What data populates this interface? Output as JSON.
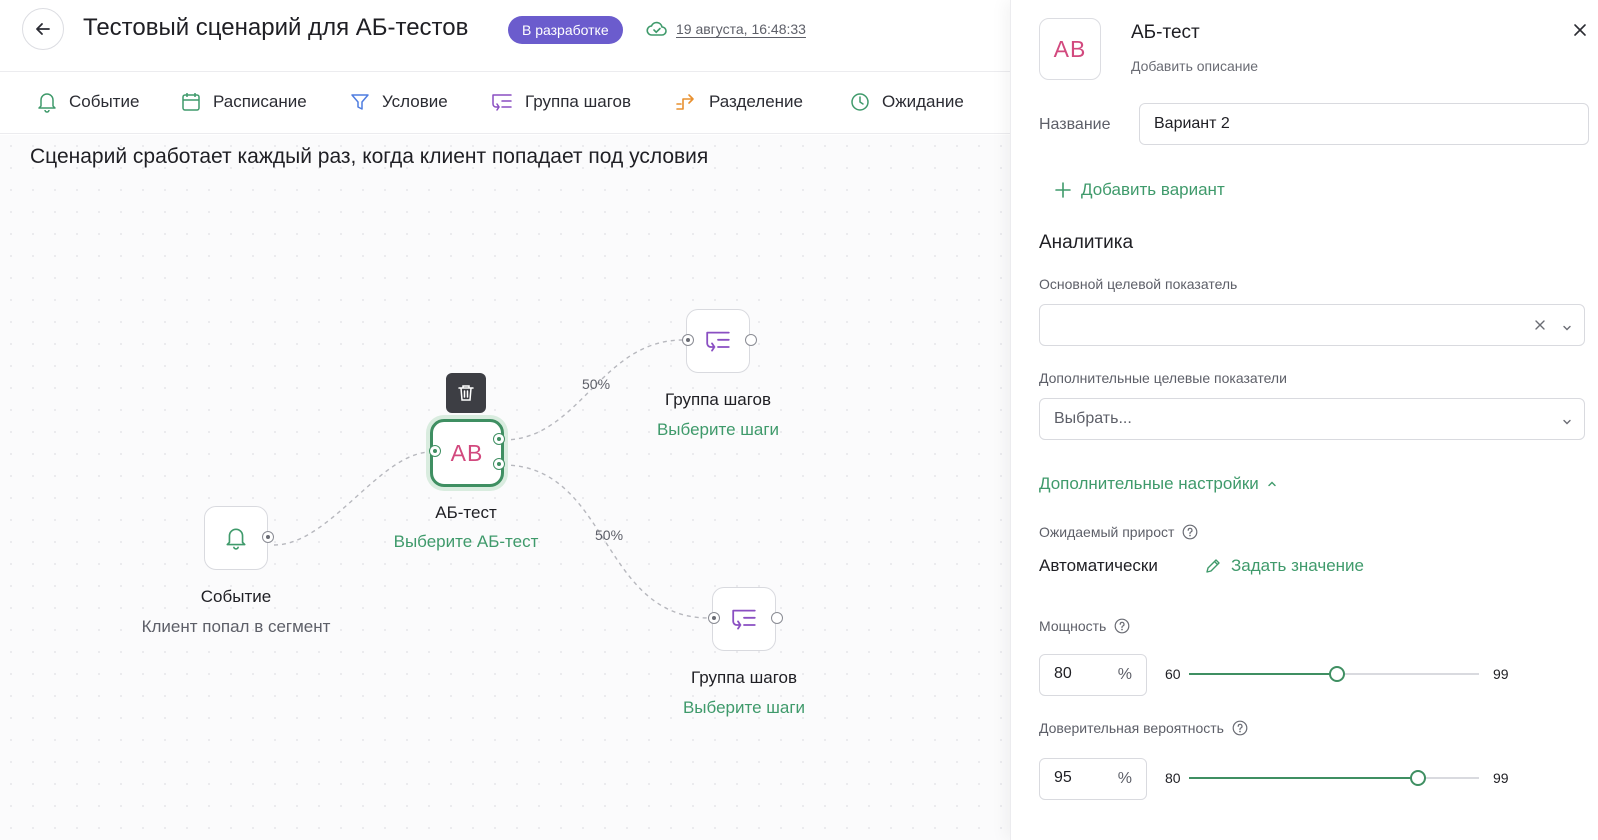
{
  "header": {
    "title": "Тестовый сценарий для АБ-тестов",
    "status": "В разработке",
    "saved_at": "19 августа, 16:48:33"
  },
  "toolbar": {
    "items": [
      {
        "label": "Событие",
        "icon": "bell-icon"
      },
      {
        "label": "Расписание",
        "icon": "calendar-icon"
      },
      {
        "label": "Условие",
        "icon": "filter-icon"
      },
      {
        "label": "Группа шагов",
        "icon": "step-group-icon"
      },
      {
        "label": "Разделение",
        "icon": "split-icon"
      },
      {
        "label": "Ожидание",
        "icon": "clock-icon"
      }
    ]
  },
  "canvas": {
    "hint": "Сценарий сработает каждый раз, когда клиент попадает под условия",
    "nodes": {
      "event": {
        "title": "Событие",
        "subtitle": "Клиент попал в сегмент"
      },
      "ab_test": {
        "icon_text": "AB",
        "title": "АБ-тест",
        "subtitle": "Выберите АБ-тест"
      },
      "group_top": {
        "title": "Группа шагов",
        "subtitle": "Выберите шаги"
      },
      "group_bottom": {
        "title": "Группа шагов",
        "subtitle": "Выберите шаги"
      }
    },
    "edge_labels": {
      "top": "50%",
      "bottom": "50%"
    }
  },
  "panel": {
    "icon_text": "AB",
    "title": "АБ-тест",
    "add_description": "Добавить описание",
    "name_label": "Название",
    "name_value": "Вариант 2",
    "add_variant": "Добавить вариант",
    "analytics_title": "Аналитика",
    "primary_metric_label": "Основной целевой показатель",
    "primary_metric_value": "",
    "extra_metrics_label": "Дополнительные целевые показатели",
    "extra_metrics_placeholder": "Выбрать...",
    "advanced_settings": "Дополнительные настройки",
    "expected_growth_label": "Ожидаемый прирост",
    "expected_growth_value": "Автоматически",
    "set_value": "Задать значение",
    "power": {
      "label": "Мощность",
      "value": "80",
      "unit": "%",
      "min": "60",
      "max": "99",
      "fraction": 0.51
    },
    "confidence": {
      "label": "Доверительная вероятность",
      "value": "95",
      "unit": "%",
      "min": "80",
      "max": "99",
      "fraction": 0.79
    }
  },
  "colors": {
    "accent_green": "#3f9a6b",
    "status_purple": "#6b5ccd",
    "ab_pink": "#d2497e",
    "group_icon_purple": "#8a4fc2",
    "split_icon_orange": "#e8902f"
  }
}
